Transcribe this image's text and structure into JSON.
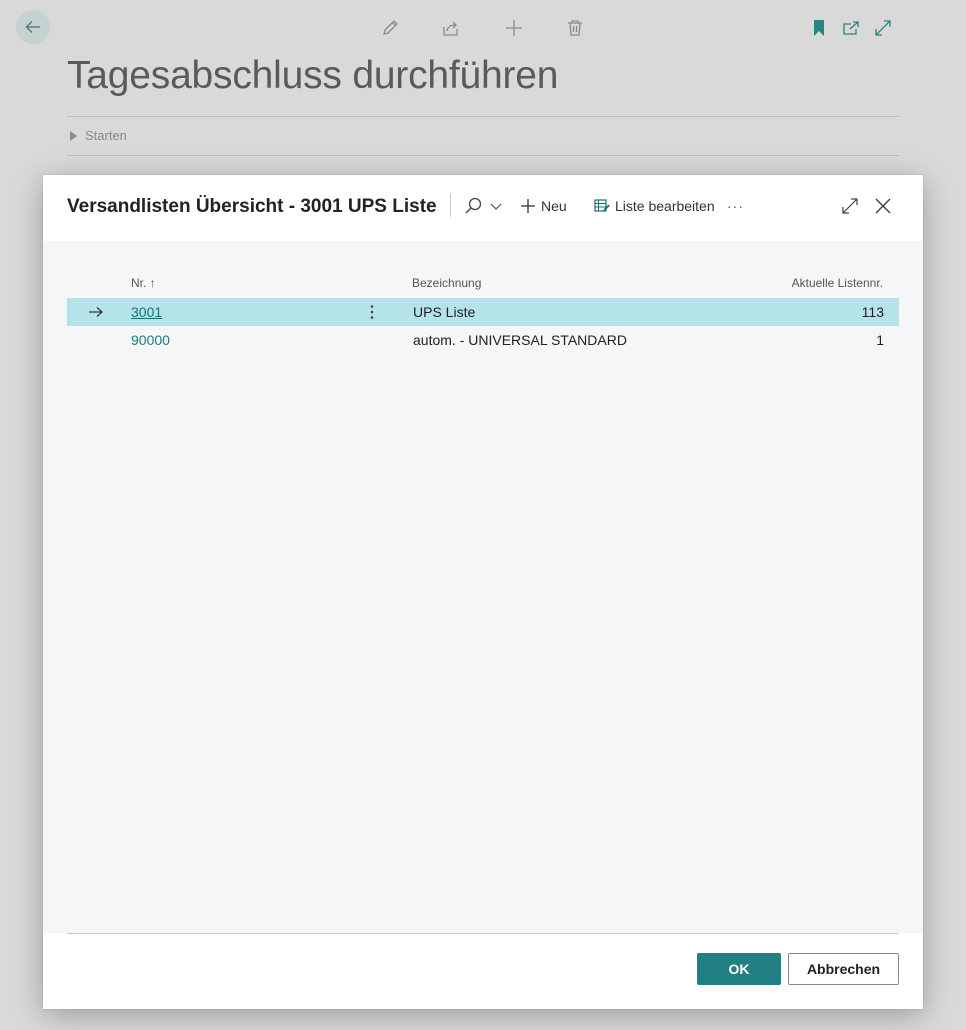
{
  "background_page": {
    "title": "Tagesabschluss durchführen",
    "section_label": "Starten",
    "toolbar_icons": [
      "edit-icon",
      "share-icon",
      "add-icon",
      "delete-icon",
      "bookmark-icon",
      "open-new-window-icon",
      "expand-icon"
    ],
    "accent_color": "#2b8286"
  },
  "dialog": {
    "title": "Versandlisten Übersicht - 3001 UPS Liste",
    "actions": {
      "new_label": "Neu",
      "edit_list_label": "Liste bearbeiten",
      "more_label": "···"
    },
    "table": {
      "columns": {
        "nr": "Nr.",
        "nr_sort": "↑",
        "description": "Bezeichnung",
        "current_list_no": "Aktuelle Listennr."
      },
      "rows": [
        {
          "nr": "3001",
          "description": "UPS Liste",
          "current_list_no": "113",
          "selected": true
        },
        {
          "nr": "90000",
          "description": "autom. - UNIVERSAL STANDARD",
          "current_list_no": "1",
          "selected": false
        }
      ]
    },
    "footer": {
      "ok_label": "OK",
      "cancel_label": "Abbrechen"
    },
    "colors": {
      "selected_row": "#b4e4ea",
      "link": "#1f7b80",
      "primary_button": "#227f84"
    }
  }
}
